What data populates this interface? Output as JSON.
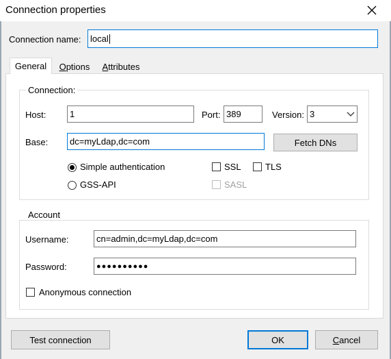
{
  "window": {
    "title": "Connection properties"
  },
  "connection_name": {
    "label": "Connection name:",
    "value": "local"
  },
  "tabs": [
    {
      "label": "General"
    },
    {
      "label": "Options"
    },
    {
      "label": "Attributes"
    }
  ],
  "connection_group": {
    "title": "Connection:",
    "host_label": "Host:",
    "host_value": "1",
    "port_label": "Port:",
    "port_value": "389",
    "version_label": "Version:",
    "version_value": "3",
    "base_label": "Base:",
    "base_value": "dc=myLdap,dc=com",
    "fetch_dns_label": "Fetch DNs",
    "simple_auth_label": "Simple authentication",
    "gss_api_label": "GSS-API",
    "ssl_label": "SSL",
    "tls_label": "TLS",
    "sasl_label": "SASL"
  },
  "account_group": {
    "title": "Account",
    "username_label": "Username:",
    "username_value": "cn=admin,dc=myLdap,dc=com",
    "password_label": "Password:",
    "password_value": "●●●●●●●●●●",
    "anonymous_label": "Anonymous connection"
  },
  "buttons": {
    "test_connection": "Test connection",
    "ok": "OK",
    "cancel": "Cancel"
  }
}
